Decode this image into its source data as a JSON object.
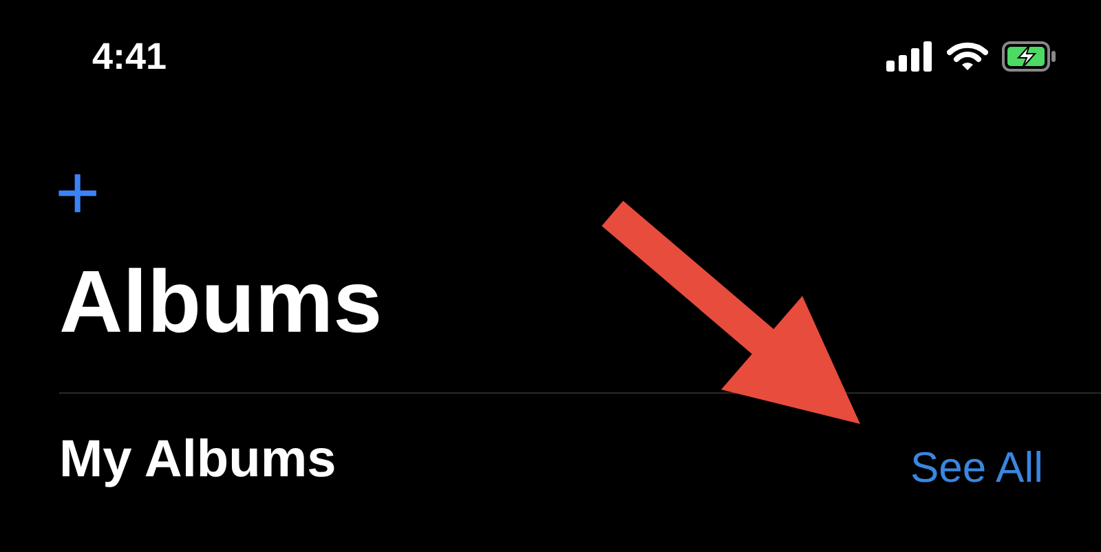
{
  "status_bar": {
    "time": "4:41"
  },
  "nav": {
    "add_button": "+"
  },
  "title": "Albums",
  "section": {
    "title": "My Albums",
    "link": "See All"
  }
}
